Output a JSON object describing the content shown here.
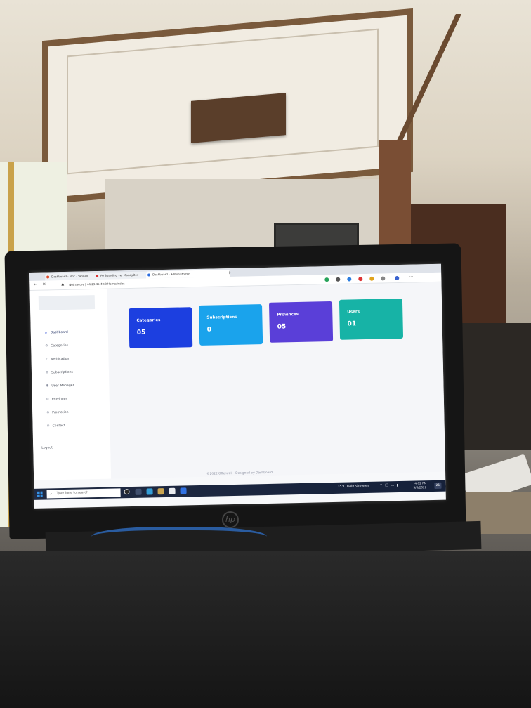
{
  "browser": {
    "tabs": [
      {
        "label": "Dashboard - vlbc - Yandex",
        "active": false
      },
      {
        "label": "Pe Boarding ver MoneyDev",
        "active": false
      },
      {
        "label": "Dashboard - Administrator",
        "active": true
      }
    ],
    "url_warning": "Not secure",
    "url": "|  44.23.45.40:8/Home/Index"
  },
  "sidebar": {
    "items": [
      {
        "label": "Dashboard",
        "icon": "home-icon",
        "glyph": "⌂",
        "active": true
      },
      {
        "label": "Categories",
        "icon": "gear-icon",
        "glyph": "⚙",
        "active": false
      },
      {
        "label": "Verification",
        "icon": "check-icon",
        "glyph": "✓",
        "active": false
      },
      {
        "label": "Subscriptions",
        "icon": "gear-icon",
        "glyph": "⚙",
        "active": false
      },
      {
        "label": "User Manager",
        "icon": "user-icon",
        "glyph": "⚉",
        "active": false
      },
      {
        "label": "Provinces",
        "icon": "gear-icon",
        "glyph": "⚙",
        "active": false
      },
      {
        "label": "Promotion",
        "icon": "gear-icon",
        "glyph": "⚙",
        "active": false
      },
      {
        "label": "Contact",
        "icon": "gear-icon",
        "glyph": "⚙",
        "active": false
      }
    ],
    "logout": "Logout"
  },
  "cards": [
    {
      "title": "Categories",
      "value": "05",
      "color": "#1c3fe0"
    },
    {
      "title": "Subscriptions",
      "value": "0",
      "color": "#1aa3ec"
    },
    {
      "title": "Provinces",
      "value": "05",
      "color": "#5a3fd8"
    },
    {
      "title": "Users",
      "value": "01",
      "color": "#17b3a6"
    }
  ],
  "footer": "©2022 Offerwall - Designed by Dashboard",
  "taskbar": {
    "search_placeholder": "Type here to search",
    "weather": "35°C  Rain showers",
    "time": "4:02 PM",
    "date": "9/8/2022",
    "notifications": "21"
  }
}
